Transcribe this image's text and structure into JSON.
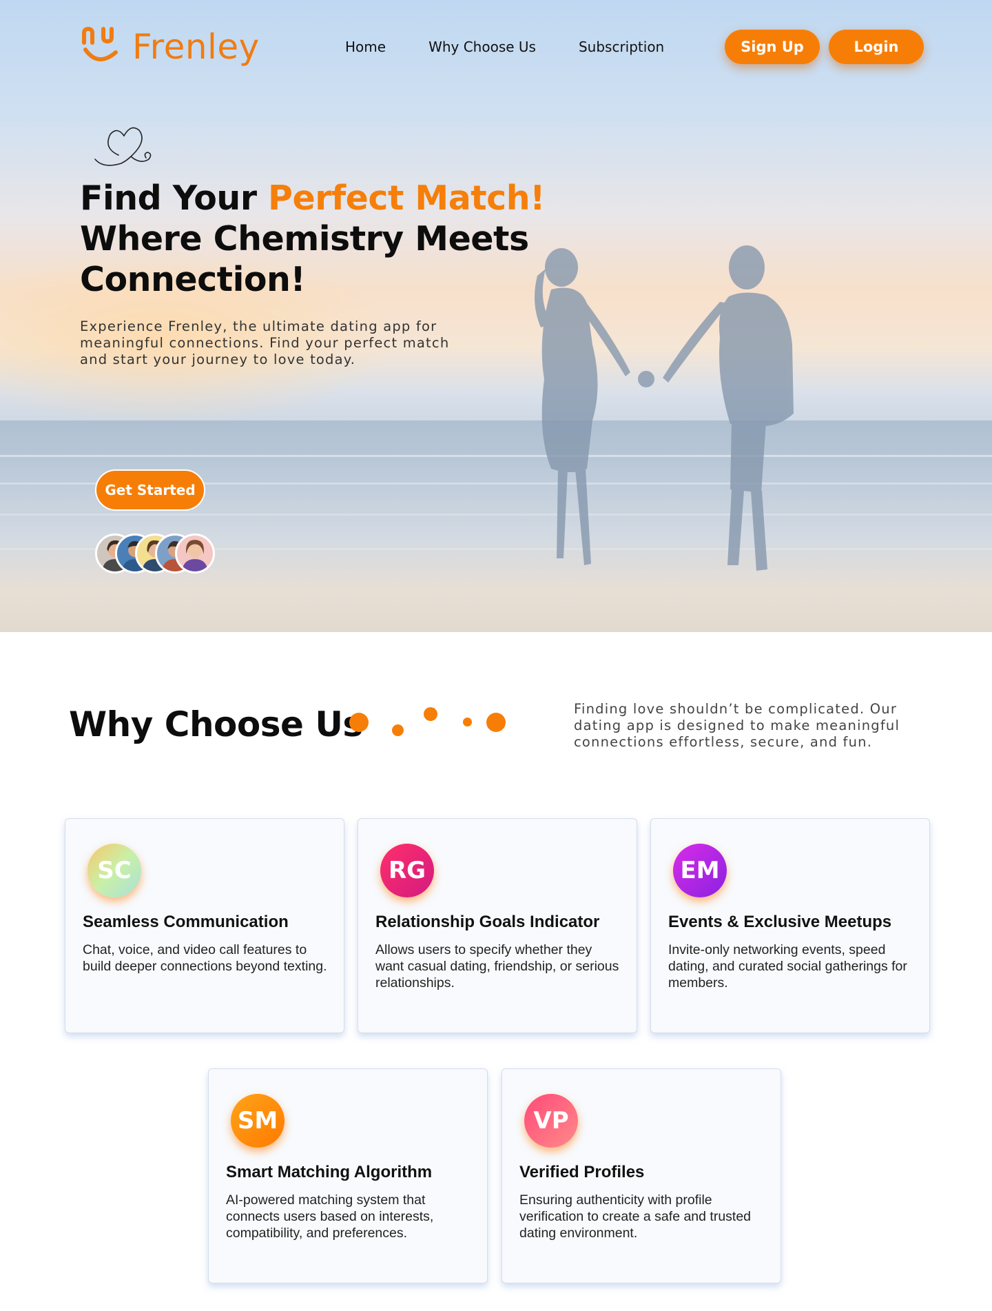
{
  "brand": {
    "name": "Frenley",
    "accent": "#f77e06"
  },
  "nav": {
    "items": [
      "Home",
      "Why Choose Us",
      "Subscription"
    ]
  },
  "auth": {
    "signup_label": "Sign Up",
    "login_label": "Login"
  },
  "hero": {
    "title_line1_plain": "Find Your ",
    "title_line1_accent": "Perfect Match!",
    "title_line2": "Where Chemistry Meets",
    "title_line3": "Connection!",
    "description": "Experience Frenley, the ultimate dating app for meaningful connections. Find your perfect match and start your journey to love today.",
    "cta_label": "Get Started"
  },
  "why": {
    "title": "Why Choose Us",
    "description": "Finding love shouldn’t be complicated. Our dating app is designed to make meaningful connections effortless, secure, and fun.",
    "features": [
      {
        "initials": "SC",
        "title": "Seamless Communication",
        "text": "Chat, voice, and video call features to build deeper connections beyond texting."
      },
      {
        "initials": "RG",
        "title": "Relationship Goals Indicator",
        "text": "Allows users to specify whether they want casual dating, friendship, or serious relationships."
      },
      {
        "initials": "EM",
        "title": "Events & Exclusive Meetups",
        "text": "Invite-only networking events, speed dating, and curated social gatherings for members."
      },
      {
        "initials": "SM",
        "title": "Smart Matching Algorithm",
        "text": "AI-powered matching system that connects users based on interests, compatibility, and preferences."
      },
      {
        "initials": "VP",
        "title": "Verified Profiles",
        "text": "Ensuring authenticity with profile verification to create a safe and trusted dating environment."
      }
    ]
  }
}
